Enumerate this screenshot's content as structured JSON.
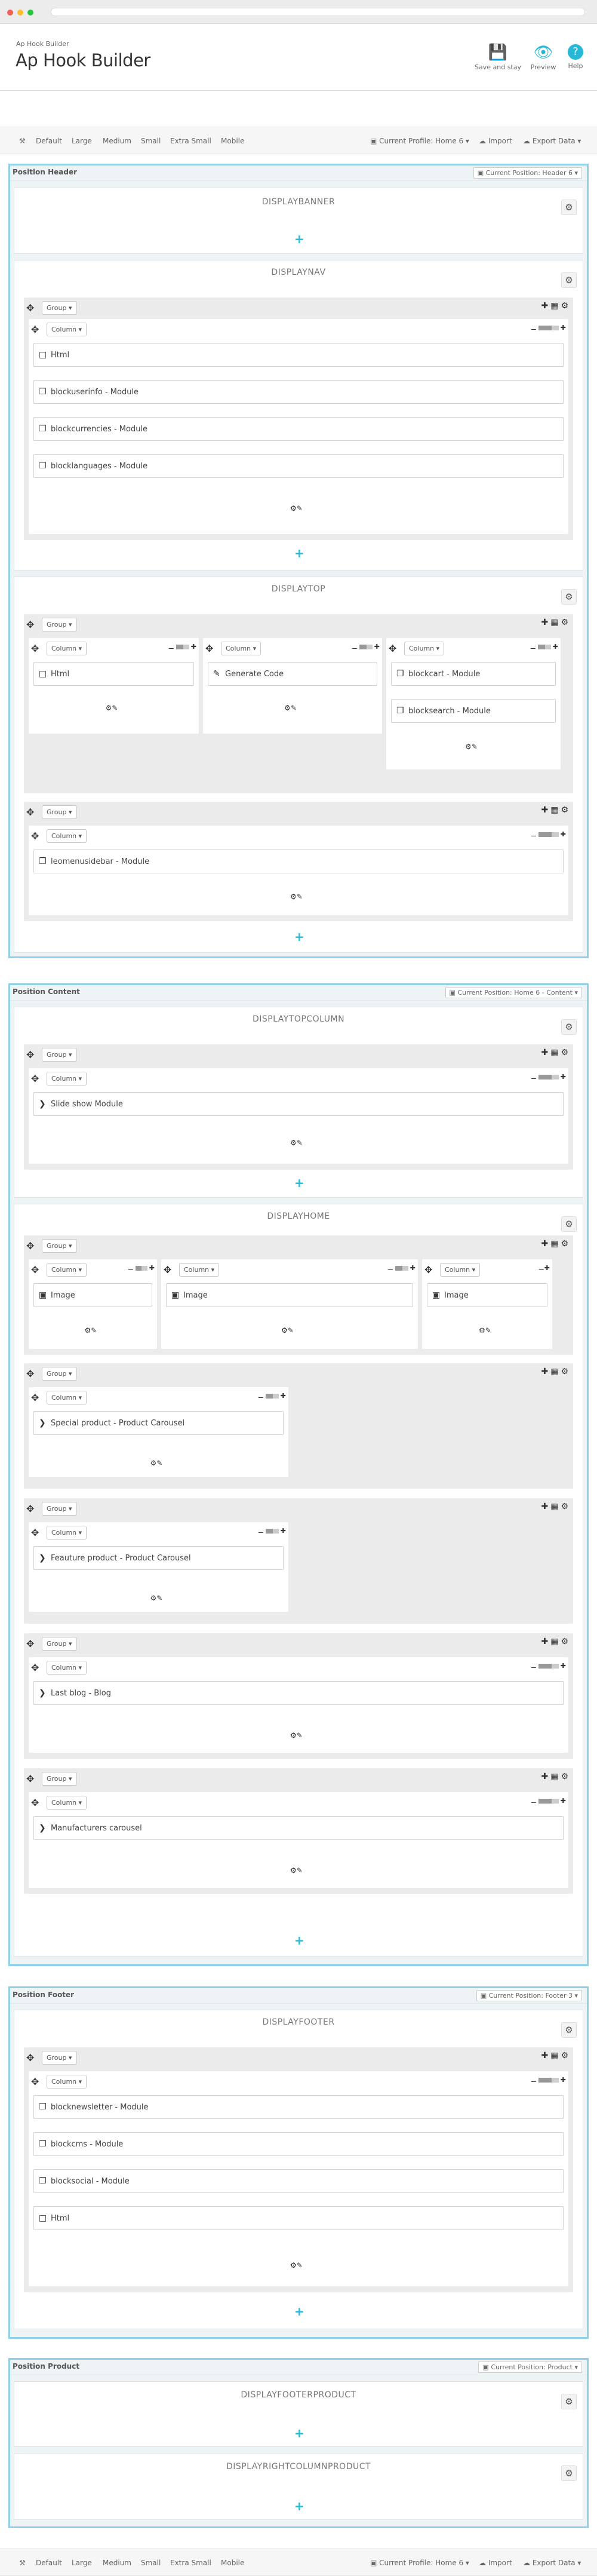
{
  "header": {
    "breadcrumb": "Ap Hook Builder",
    "title": "Ap Hook Builder",
    "buttons": {
      "save": "Save and stay",
      "preview": "Preview",
      "help": "Help"
    }
  },
  "toolbar": {
    "views": [
      "Default",
      "Large",
      "Medium",
      "Small",
      "Extra Small",
      "Mobile"
    ],
    "profile": "Current Profile: Home 6",
    "import": "Import",
    "export": "Export Data"
  },
  "common": {
    "group": "Group",
    "column": "Column"
  },
  "sections": {
    "header": {
      "title": "Position Header",
      "current": "Current Position: Header 6",
      "hooks": {
        "banner": "DISPLAYBANNER",
        "nav": "DISPLAYNAV",
        "nav_widgets": [
          "Html",
          "blockuserinfo - Module",
          "blockcurrencies - Module",
          "blocklanguages - Module"
        ],
        "top": "DISPLAYTOP",
        "top_widgets": [
          "Html",
          "Generate Code",
          "blockcart - Module",
          "blocksearch - Module",
          "leomenusidebar - Module"
        ]
      }
    },
    "content": {
      "title": "Position Content",
      "current": "Current Position: Home 6 - Content",
      "hooks": {
        "topcolumn": "DISPLAYTOPCOLUMN",
        "topcolumn_widgets": [
          "Slide show Module"
        ],
        "home": "DISPLAYHOME",
        "home_widgets": [
          "Image",
          "Image",
          "Image",
          "Special product - Product Carousel",
          "Feauture product - Product Carousel",
          "Last blog - Blog",
          "Manufacturers carousel"
        ]
      }
    },
    "footer": {
      "title": "Position Footer",
      "current": "Current Position: Footer 3",
      "hooks": {
        "footer": "DISPLAYFOOTER",
        "footer_widgets": [
          "blocknewsletter - Module",
          "blockcms - Module",
          "blocksocial - Module",
          "Html"
        ]
      }
    },
    "product": {
      "title": "Position Product",
      "current": "Current Position: Product",
      "hooks": {
        "footerproduct": "DISPLAYFOOTERPRODUCT",
        "rightcolumnproduct": "DISPLAYRIGHTCOLUMNPRODUCT"
      }
    }
  },
  "colors": {
    "accent": "#25b9d7",
    "section_border": "#8fd0e8"
  }
}
